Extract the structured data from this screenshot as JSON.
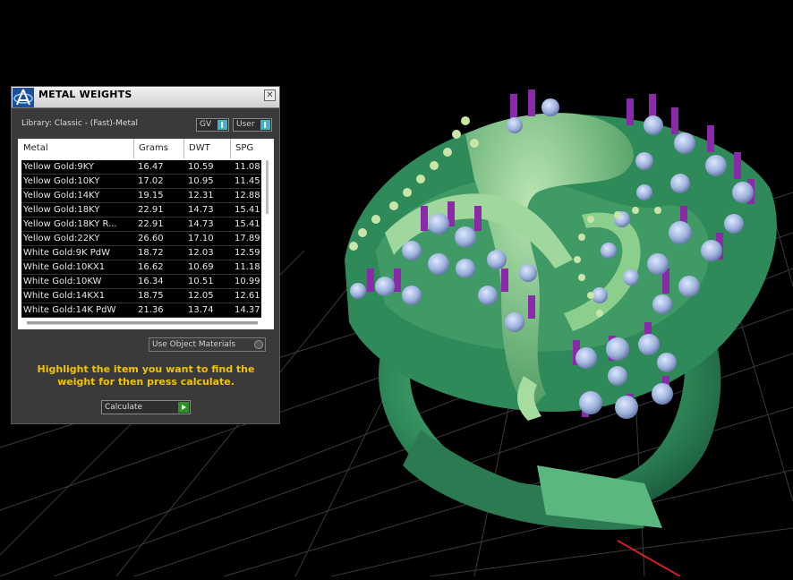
{
  "panel": {
    "title": "METAL WEIGHTS",
    "close_glyph": "✕",
    "library_label": "Library: Classic - (Fast)-Metal",
    "gv_dropdown": "GV",
    "user_dropdown": "User",
    "columns": [
      "Metal",
      "Grams",
      "DWT",
      "SPG"
    ],
    "rows": [
      [
        "Yellow Gold:9KY",
        "16.47",
        "10.59",
        "11.08"
      ],
      [
        "Yellow Gold:10KY",
        "17.02",
        "10.95",
        "11.45"
      ],
      [
        "Yellow Gold:14KY",
        "19.15",
        "12.31",
        "12.88"
      ],
      [
        "Yellow Gold:18KY",
        "22.91",
        "14.73",
        "15.41"
      ],
      [
        "Yellow Gold:18KY R...",
        "22.91",
        "14.73",
        "15.41"
      ],
      [
        "Yellow Gold:22KY",
        "26.60",
        "17.10",
        "17.89"
      ],
      [
        "White Gold:9K PdW",
        "18.72",
        "12.03",
        "12.59"
      ],
      [
        "White Gold:10KX1",
        "16.62",
        "10.69",
        "11.18"
      ],
      [
        "White Gold:10KW",
        "16.34",
        "10.51",
        "10.99"
      ],
      [
        "White Gold:14KX1",
        "18.75",
        "12.05",
        "12.61"
      ],
      [
        "White Gold:14K PdW",
        "21.36",
        "13.74",
        "14.37"
      ]
    ],
    "use_object_materials": "Use Object Materials",
    "hint": "Highlight the item you want to find the weight for then press calculate.",
    "calculate_label": "Calculate"
  },
  "icons": {
    "logo": "app-logo-icon",
    "close": "close-icon",
    "calculate": "play-icon"
  },
  "colors": {
    "accent_teal": "#3cb6c4",
    "hint_yellow": "#f2c400",
    "calc_green": "#2f8f2a",
    "ring_green": "#2e8a5a",
    "stone_blue": "#9fb7e0",
    "prong_purple": "#8a2aa8"
  }
}
